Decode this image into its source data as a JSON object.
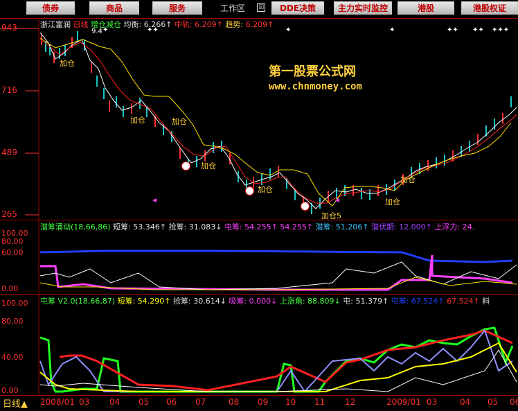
{
  "toolbar": {
    "buttons": [
      "债券",
      "商品",
      "服务",
      "DDE决策",
      "主力实时监控",
      "港股",
      "港股权证"
    ],
    "work_area": "工作区",
    "work_area_icon": "☒"
  },
  "main_chart": {
    "title_parts": [
      "浙江富润",
      "日线",
      "增仓减仓",
      "均衡:",
      "6.266↑",
      "中轨:",
      "6.209↑",
      "趋势:",
      "6.209↑"
    ],
    "y_labels": [
      "943",
      "716",
      "489",
      "265"
    ],
    "watermark_title": "第一股票公式网",
    "watermark_url": "www.chnmoney.com",
    "markers": [
      "加仓",
      "加仓",
      "加仓",
      "加仓",
      "加仓",
      "加仓5",
      "加仓",
      "加仓"
    ],
    "peak_label": "9.4"
  },
  "pane2": {
    "legend": [
      "潜筹涌动(18,66,86)",
      "短筹: 53.346↑",
      "抢筹: 31.083↓",
      "屯筹: 54.255↑",
      "54.255↑",
      "潜筹: 51.206↑",
      "潜伏期: 12.000↑",
      "上浮力: 24."
    ],
    "y_labels": [
      "100.00",
      "80.00",
      "60.00",
      "0.00"
    ]
  },
  "pane3": {
    "legend": [
      "屯筹 V2.0(18,66,87)",
      "短筹: 54.290↑",
      "抢筹: 30.614↓",
      "吸筹: 0.000↓",
      "上涨角: 88.809↓",
      "屯: 51.379↑",
      "屯筹: 67.524↑",
      "67.524↑",
      "料"
    ],
    "y_labels": [
      "100.00",
      "80.00",
      "40.00",
      "0.00"
    ]
  },
  "date_axis": {
    "period": "日线",
    "labels": [
      "2008/01",
      "03",
      "04",
      "05",
      "06",
      "07",
      "08",
      "09",
      "10",
      "11",
      "12",
      "2009/01",
      "03",
      "04",
      "05",
      "06"
    ]
  },
  "colors": {
    "red": "#ff3030",
    "yellow": "#ffd040",
    "white": "#ffffff",
    "magenta": "#ff40ff",
    "blue": "#2040ff"
  }
}
